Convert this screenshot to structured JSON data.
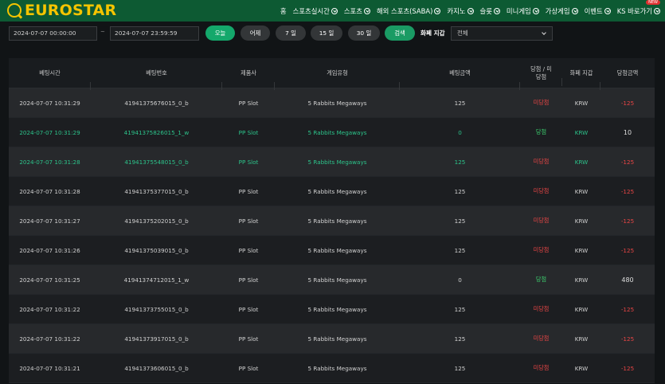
{
  "brand": {
    "logo_text": "EUROSTAR",
    "color": "#f5c400"
  },
  "nav": {
    "items": [
      {
        "label": "홈",
        "chevron": false
      },
      {
        "label": "스포츠실시간",
        "chevron": true
      },
      {
        "label": "스포츠",
        "chevron": true
      },
      {
        "label": "해외 스포츠(SABA)",
        "chevron": true
      },
      {
        "label": "카지노",
        "chevron": true
      },
      {
        "label": "슬롯",
        "chevron": true
      },
      {
        "label": "미니게임",
        "chevron": true
      },
      {
        "label": "가상게임",
        "chevron": true
      },
      {
        "label": "이벤트",
        "chevron": true
      },
      {
        "label": "KS 바로가기",
        "chevron": true,
        "badge": "NEW"
      }
    ]
  },
  "filters": {
    "start_date": "2024-07-07 00:00:00",
    "separator": "~",
    "end_date": "2024-07-07 23:59:59",
    "quick_buttons": [
      "오늘",
      "어제",
      "7 일",
      "15 일",
      "30 일"
    ],
    "active_quick": "오늘",
    "search_label": "검색",
    "currency_label": "화폐 지갑",
    "currency_value": "전체"
  },
  "table": {
    "headers": [
      "베팅시간",
      "베팅번호",
      "제품사",
      "게임유형",
      "베팅금액",
      "당첨 / 미당첨",
      "화폐 지갑",
      "당첨금액"
    ],
    "rows": [
      {
        "time": "2024-07-07 10:31:29",
        "bet_id": "41941375676015_0_b",
        "provider": "PP Slot",
        "game": "5 Rabbits Megaways",
        "amount": "125",
        "result": "미당첨",
        "currency": "KRW",
        "payout": "-125",
        "highlight": false
      },
      {
        "time": "2024-07-07 10:31:29",
        "bet_id": "41941375826015_1_w",
        "provider": "PP Slot",
        "game": "5 Rabbits Megaways",
        "amount": "0",
        "result": "당첨",
        "currency": "KRW",
        "payout": "10",
        "highlight": true
      },
      {
        "time": "2024-07-07 10:31:28",
        "bet_id": "41941375548015_0_b",
        "provider": "PP Slot",
        "game": "5 Rabbits Megaways",
        "amount": "125",
        "result": "미당첨",
        "currency": "KRW",
        "payout": "-125",
        "highlight": true
      },
      {
        "time": "2024-07-07 10:31:28",
        "bet_id": "41941375377015_0_b",
        "provider": "PP Slot",
        "game": "5 Rabbits Megaways",
        "amount": "125",
        "result": "미당첨",
        "currency": "KRW",
        "payout": "-125",
        "highlight": false
      },
      {
        "time": "2024-07-07 10:31:27",
        "bet_id": "41941375202015_0_b",
        "provider": "PP Slot",
        "game": "5 Rabbits Megaways",
        "amount": "125",
        "result": "미당첨",
        "currency": "KRW",
        "payout": "-125",
        "highlight": false
      },
      {
        "time": "2024-07-07 10:31:26",
        "bet_id": "41941375039015_0_b",
        "provider": "PP Slot",
        "game": "5 Rabbits Megaways",
        "amount": "125",
        "result": "미당첨",
        "currency": "KRW",
        "payout": "-125",
        "highlight": false
      },
      {
        "time": "2024-07-07 10:31:25",
        "bet_id": "41941374712015_1_w",
        "provider": "PP Slot",
        "game": "5 Rabbits Megaways",
        "amount": "0",
        "result": "당첨",
        "currency": "KRW",
        "payout": "480",
        "highlight": false
      },
      {
        "time": "2024-07-07 10:31:22",
        "bet_id": "41941373755015_0_b",
        "provider": "PP Slot",
        "game": "5 Rabbits Megaways",
        "amount": "125",
        "result": "미당첨",
        "currency": "KRW",
        "payout": "-125",
        "highlight": false
      },
      {
        "time": "2024-07-07 10:31:22",
        "bet_id": "41941373917015_0_b",
        "provider": "PP Slot",
        "game": "5 Rabbits Megaways",
        "amount": "125",
        "result": "미당첨",
        "currency": "KRW",
        "payout": "-125",
        "highlight": false
      },
      {
        "time": "2024-07-07 10:31:21",
        "bet_id": "41941373606015_0_b",
        "provider": "PP Slot",
        "game": "5 Rabbits Megaways",
        "amount": "125",
        "result": "미당첨",
        "currency": "KRW",
        "payout": "-125",
        "highlight": false
      }
    ]
  },
  "colors": {
    "accent": "#14a86b",
    "header_bg": "#0d5a33",
    "lose": "#e84545",
    "win": "#3ccf6e",
    "highlight_text": "#2cc38a"
  }
}
